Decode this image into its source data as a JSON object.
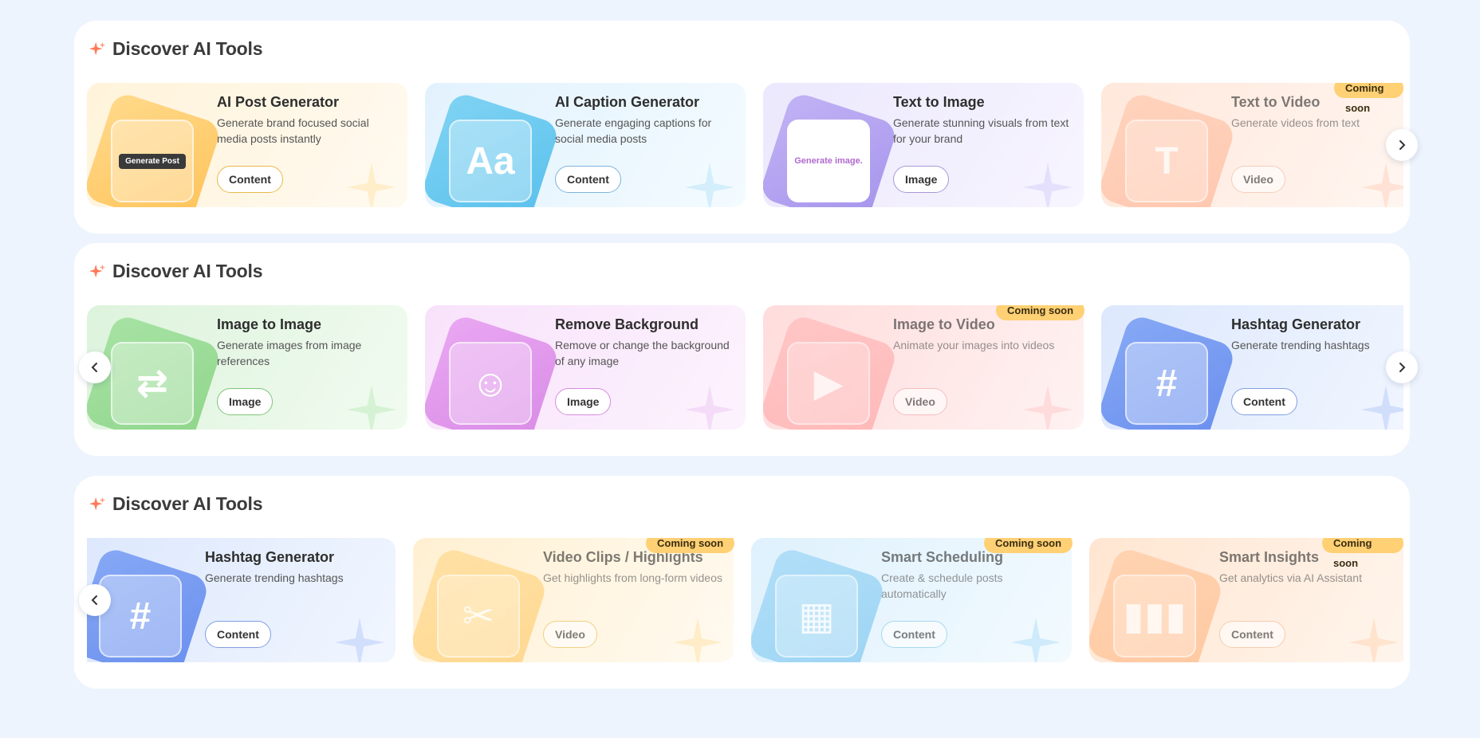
{
  "sections": [
    {
      "title": "Discover AI Tools",
      "cards": [
        {
          "title": "AI Post Generator",
          "desc": "Generate brand focused social media posts instantly",
          "tag": "Content",
          "icon": "post-generator-icon",
          "art_label": "Generate Post"
        },
        {
          "title": "AI Caption Generator",
          "desc": "Generate engaging captions for social media posts",
          "tag": "Content",
          "icon": "caption-icon",
          "art_label": "Aa"
        },
        {
          "title": "Text to Image",
          "desc": "Generate stunning visuals from text for your brand",
          "tag": "Image",
          "icon": "text-to-image-icon",
          "art_label": "Generate image."
        },
        {
          "title": "Text to Video",
          "desc": "Generate videos from text",
          "tag": "Video",
          "icon": "text-to-video-icon",
          "badge": "Coming soon"
        }
      ]
    },
    {
      "title": "Discover AI Tools",
      "cards": [
        {
          "title": "Image to Image",
          "desc": "Generate images from image references",
          "tag": "Image",
          "icon": "image-to-image-icon"
        },
        {
          "title": "Remove Background",
          "desc": "Remove or change the background of any image",
          "tag": "Image",
          "icon": "remove-background-icon"
        },
        {
          "title": "Image to Video",
          "desc": "Animate your images into videos",
          "tag": "Video",
          "icon": "image-to-video-icon",
          "badge": "Coming soon"
        },
        {
          "title": "Hashtag Generator",
          "desc": "Generate trending hashtags",
          "tag": "Content",
          "icon": "hashtag-icon"
        }
      ]
    },
    {
      "title": "Discover AI Tools",
      "cards": [
        {
          "title": "Hashtag Generator",
          "desc": "Generate trending hashtags",
          "tag": "Content",
          "icon": "hashtag-icon"
        },
        {
          "title": "Video Clips / Highlights",
          "desc": "Get highlights from long-form videos",
          "tag": "Video",
          "icon": "video-clips-icon",
          "badge": "Coming soon"
        },
        {
          "title": "Smart Scheduling",
          "desc": "Create & schedule posts automatically",
          "tag": "Content",
          "icon": "calendar-icon",
          "badge": "Coming soon"
        },
        {
          "title": "Smart Insights",
          "desc": "Get analytics via AI Assistant",
          "tag": "Content",
          "icon": "bar-chart-icon",
          "badge": "Coming soon"
        }
      ]
    }
  ],
  "colors": {
    "page_bg": "#eef4fd",
    "accent_sparkle": "#ff7a59",
    "badge_bg": "#ffd074"
  }
}
